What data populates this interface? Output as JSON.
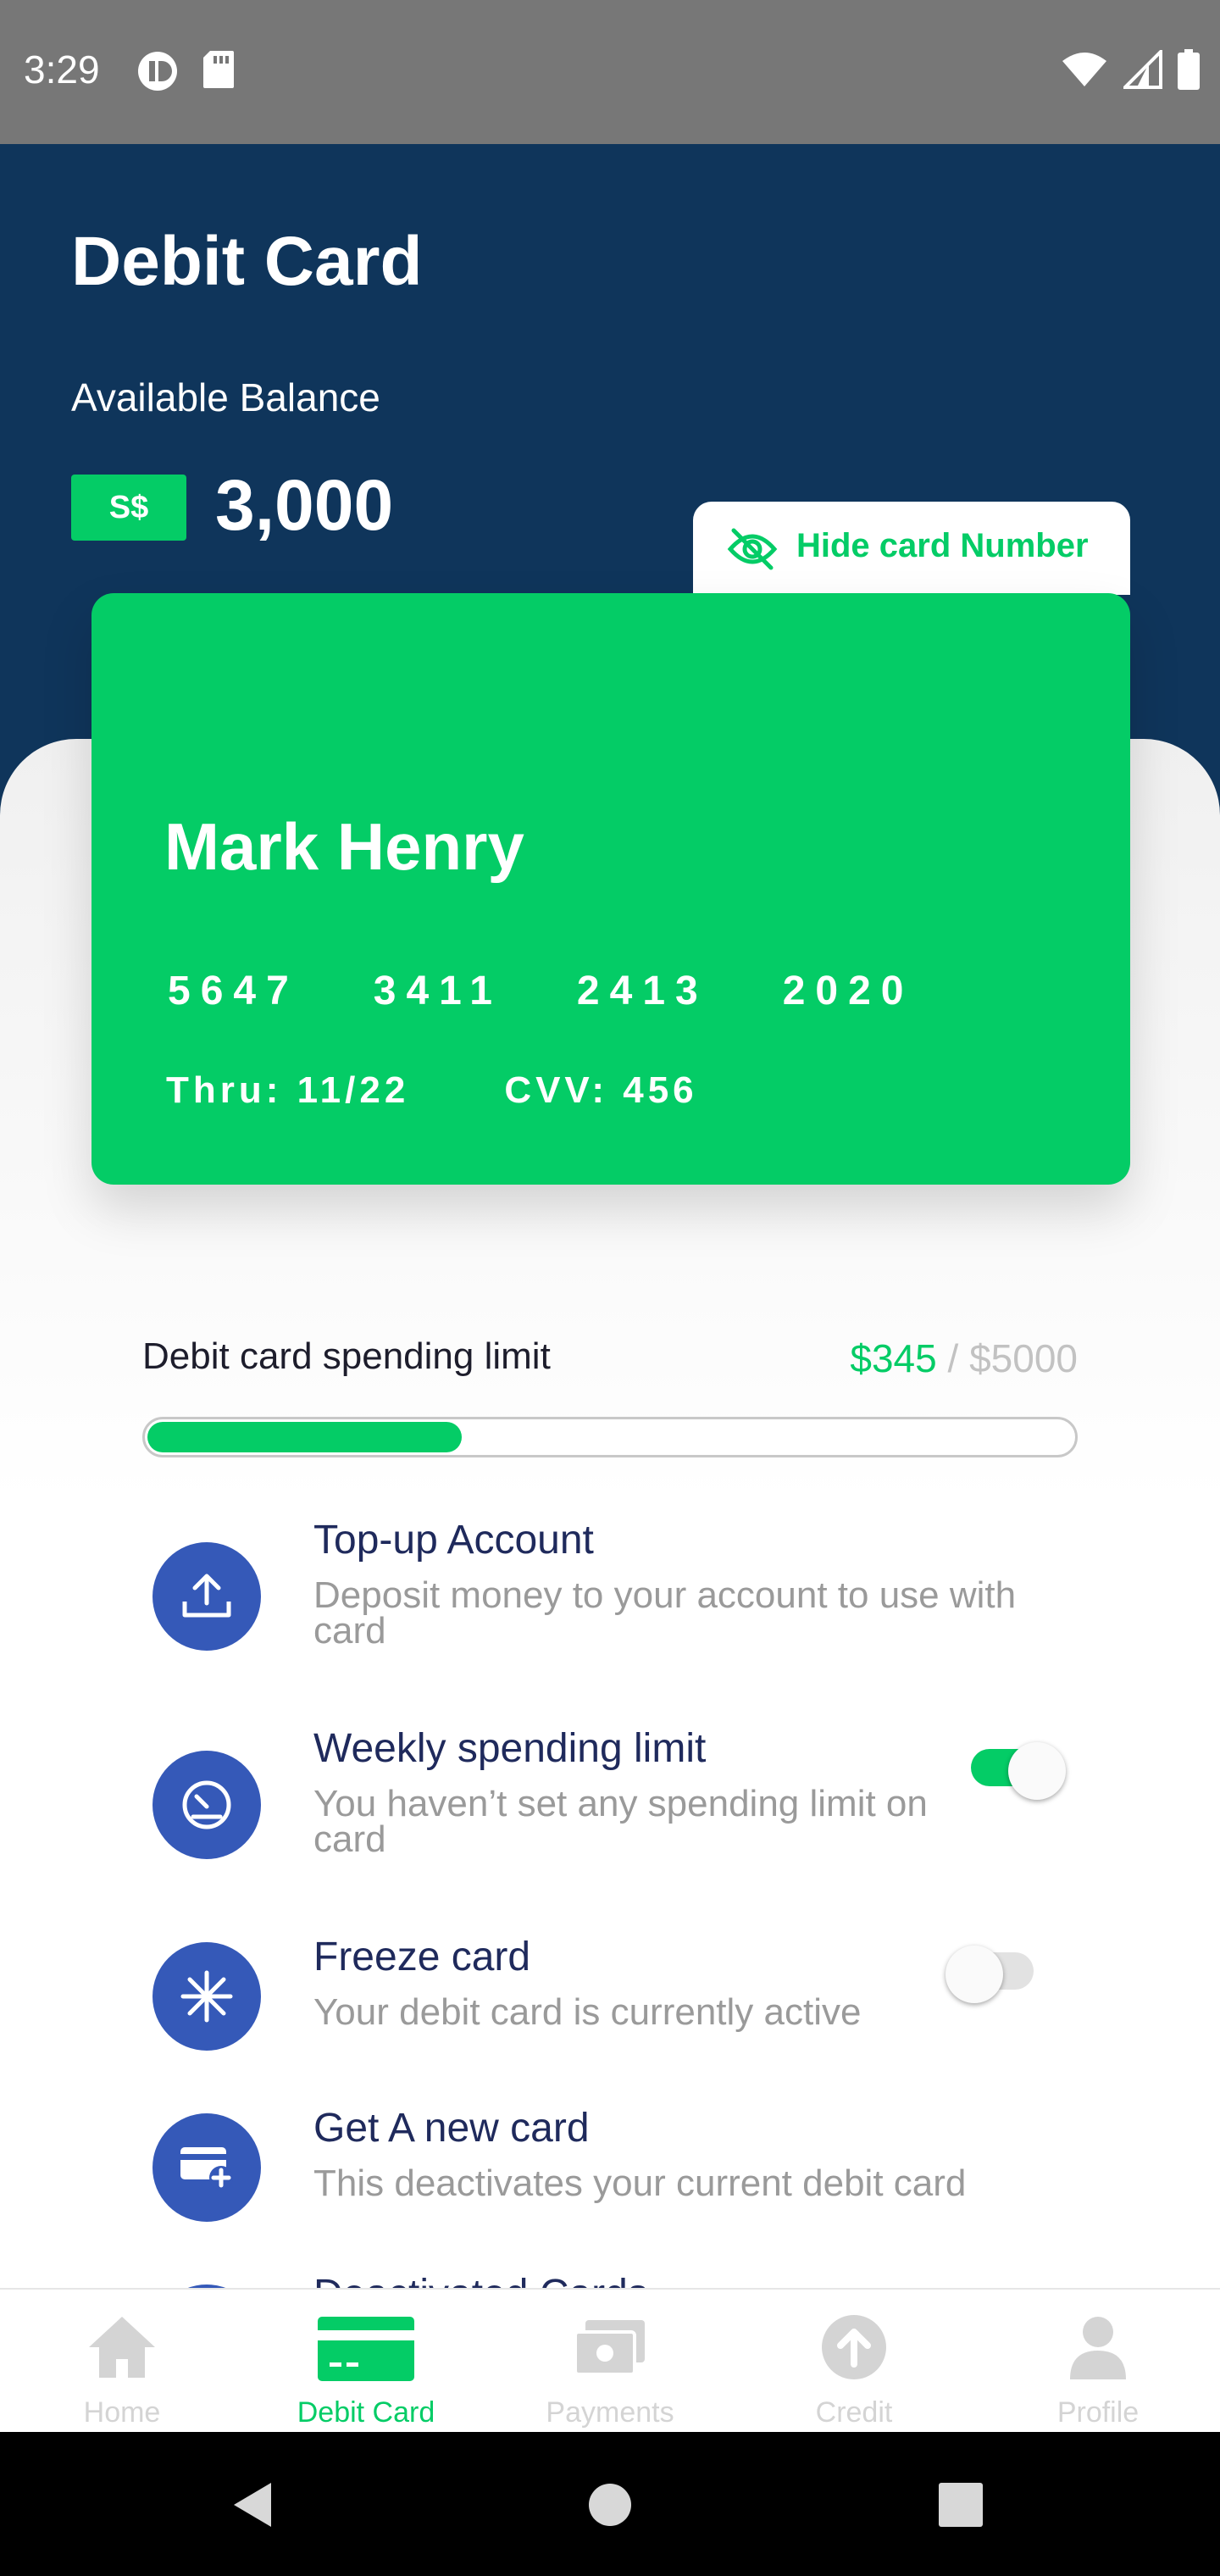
{
  "status_bar": {
    "time": "3:29"
  },
  "header": {
    "title": "Debit Card",
    "balance_label": "Available Balance",
    "currency": "S$",
    "balance": "3,000"
  },
  "hide_card": {
    "label": "Hide card Number"
  },
  "card": {
    "holder": "Mark Henry",
    "number": [
      "5647",
      "3411",
      "2413",
      "2020"
    ],
    "thru": "Thru: 11/22",
    "cvv": "CVV: 456"
  },
  "spending_limit": {
    "label": "Debit card spending limit",
    "spent": "$345",
    "separator": " / ",
    "total": "$5000",
    "progress_fraction": 0.34
  },
  "options": [
    {
      "title": "Top-up Account",
      "subtitle": "Deposit money to your account to use with card",
      "icon": "upload-icon"
    },
    {
      "title": "Weekly spending limit",
      "subtitle": "You haven’t set any spending limit on card",
      "icon": "speedometer-icon",
      "toggle": true
    },
    {
      "title": "Freeze card",
      "subtitle": "Your debit card is currently active",
      "icon": "snowflake-icon",
      "toggle": false
    },
    {
      "title": "Get A new card",
      "subtitle": "This deactivates your current debit card",
      "icon": "new-card-icon"
    },
    {
      "title": "Deactivated Cards",
      "icon": "deactivated-cards-icon"
    }
  ],
  "bottom_nav": {
    "items": [
      {
        "label": "Home",
        "icon": "home-icon",
        "active": false
      },
      {
        "label": "Debit Card",
        "icon": "debit-card-icon",
        "active": true
      },
      {
        "label": "Payments",
        "icon": "payments-icon",
        "active": false
      },
      {
        "label": "Credit",
        "icon": "credit-icon",
        "active": false
      },
      {
        "label": "Profile",
        "icon": "profile-icon",
        "active": false
      }
    ]
  },
  "colors": {
    "primary_green": "#04cc66",
    "header_navy": "#0f355b",
    "icon_blue": "#3559b8",
    "title_navy": "#1f2a5c"
  }
}
